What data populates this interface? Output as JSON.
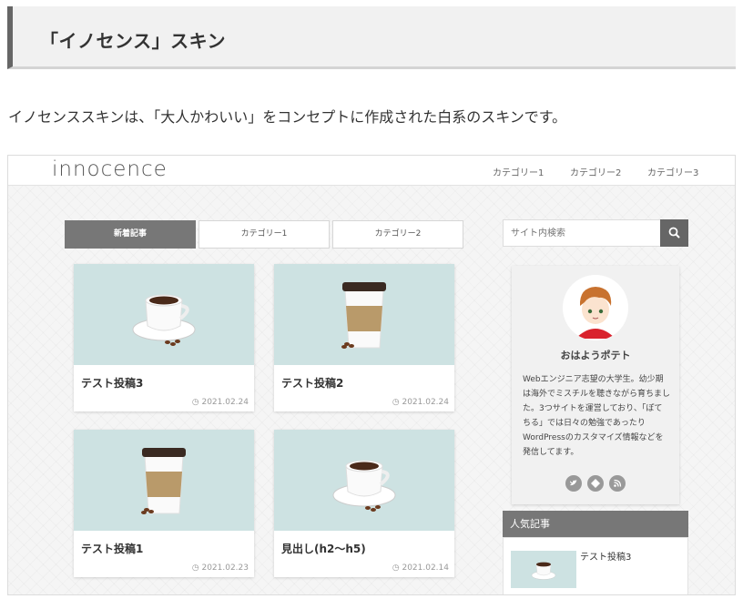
{
  "article": {
    "heading": "「イノセンス」スキン",
    "intro": "イノセンススキンは、「大人かわいい」をコンセプトに作成された白系のスキンです。"
  },
  "preview": {
    "site_logo": "innocence",
    "nav": [
      "カテゴリー1",
      "カテゴリー2",
      "カテゴリー3"
    ],
    "tabs": [
      {
        "label": "新着記事",
        "active": true
      },
      {
        "label": "カテゴリー1",
        "active": false
      },
      {
        "label": "カテゴリー2",
        "active": false
      }
    ],
    "posts": [
      {
        "title": "テスト投稿3",
        "date": "2021.02.24",
        "image": "coffee-cup"
      },
      {
        "title": "テスト投稿2",
        "date": "2021.02.24",
        "image": "paper-cup"
      },
      {
        "title": "テスト投稿1",
        "date": "2021.02.23",
        "image": "paper-cup"
      },
      {
        "title": "見出し(h2〜h5)",
        "date": "2021.02.14",
        "image": "coffee-cup"
      }
    ],
    "search": {
      "placeholder": "サイト内検索",
      "icon": "search-icon"
    },
    "profile": {
      "name": "おはようポテト",
      "description": "Webエンジニア志望の大学生。幼少期は海外でミスチルを聴きながら育ちました。3つサイトを運営しており、「ぽてちる」では日々の勉強であったりWordPressのカスタマイズ情報などを発信してます。",
      "social_icons": [
        "twitter-icon",
        "feedly-icon",
        "rss-icon"
      ]
    },
    "popular": {
      "heading": "人気記事",
      "items": [
        {
          "title": "テスト投稿3"
        }
      ]
    },
    "colors": {
      "accent_gray": "#777777",
      "thumb_bg": "#cde2e2",
      "heading_border": "#666666"
    }
  }
}
